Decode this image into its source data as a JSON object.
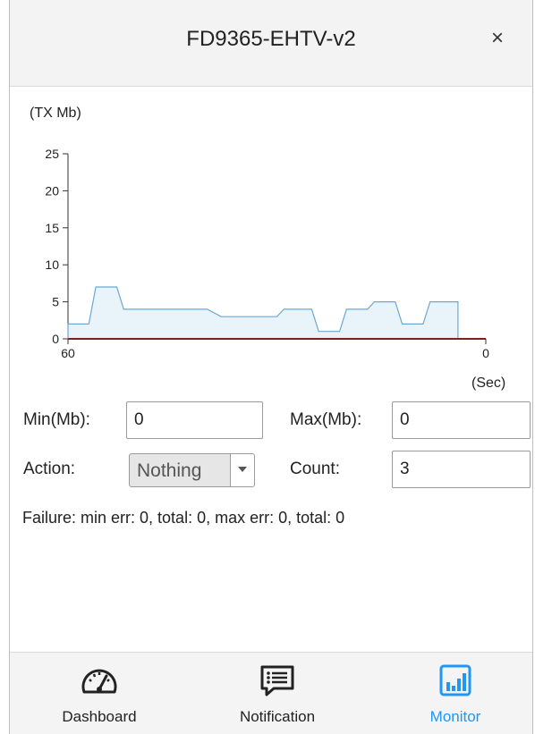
{
  "dialog": {
    "title": "FD9365-EHTV-v2",
    "close_glyph": "×"
  },
  "chart_data": {
    "type": "area",
    "ylabel": "(TX Mb)",
    "xunit": "(Sec)",
    "x_ticks": [
      "60",
      "0"
    ],
    "y_ticks": [
      "0",
      "5",
      "10",
      "15",
      "20",
      "25"
    ],
    "xlim": [
      60,
      0
    ],
    "ylim": [
      0,
      25
    ],
    "series": [
      {
        "values": [
          [
            60,
            0
          ],
          [
            60,
            2
          ],
          [
            57,
            2
          ],
          [
            56,
            7
          ],
          [
            53,
            7
          ],
          [
            52,
            4
          ],
          [
            44,
            4
          ],
          [
            40,
            4
          ],
          [
            38,
            3
          ],
          [
            30,
            3
          ],
          [
            29,
            4
          ],
          [
            25,
            4
          ],
          [
            24,
            1
          ],
          [
            21,
            1
          ],
          [
            20,
            4
          ],
          [
            17,
            4
          ],
          [
            16,
            5
          ],
          [
            13,
            5
          ],
          [
            12,
            2
          ],
          [
            9,
            2
          ],
          [
            8,
            5
          ],
          [
            4,
            5
          ],
          [
            4,
            0
          ]
        ],
        "color": "#6aa9d4",
        "fill": "#e9f3fa"
      }
    ],
    "baseline_color": "#7b1f1f"
  },
  "form": {
    "min_label": "Min(Mb):",
    "min_value": "0",
    "max_label": "Max(Mb):",
    "max_value": "0",
    "action_label": "Action:",
    "action_value": "Nothing",
    "count_label": "Count:",
    "count_value": "3"
  },
  "failure_text": "Failure: min err: 0, total: 0, max err: 0, total: 0",
  "nav": {
    "items": [
      {
        "label": "Dashboard",
        "icon": "speedometer-icon",
        "active": false
      },
      {
        "label": "Notification",
        "icon": "message-list-icon",
        "active": false
      },
      {
        "label": "Monitor",
        "icon": "bar-chart-icon",
        "active": true
      }
    ],
    "active_color": "#2196f3"
  }
}
